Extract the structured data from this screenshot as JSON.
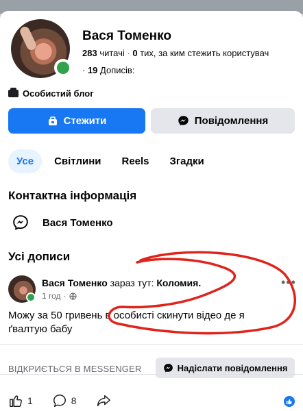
{
  "profile": {
    "name": "Вася Томенко",
    "followers_count": "283",
    "followers_label": "читачі",
    "following_count": "0",
    "following_label": "тих, за ким стежить користувач",
    "posts_count": "19",
    "posts_label": "Дописів:"
  },
  "category": "Особистий блог",
  "buttons": {
    "follow": "Стежити",
    "message": "Повідомлення"
  },
  "tabs": [
    {
      "label": "Усе",
      "active": true
    },
    {
      "label": "Світлини",
      "active": false
    },
    {
      "label": "Reels",
      "active": false
    },
    {
      "label": "Згадки",
      "active": false
    }
  ],
  "contact": {
    "title": "Контактна інформація",
    "messenger_name": "Вася Томенко"
  },
  "posts_section": {
    "title": "Усі дописи"
  },
  "post": {
    "author": "Вася Томенко",
    "location_prefix": "зараз тут:",
    "location": "Коломия.",
    "time": "1 год",
    "text": "Можу за 50 гривень в особисті скинути відео де я ґвалтую бабу",
    "messenger_prompt": "ВІДКРИЄТЬСЯ В MESSENGER",
    "send_button": "Надіслати повідомлення",
    "likes": "1",
    "comments": "8"
  },
  "colors": {
    "accent": "#1877f2",
    "online": "#31a24c",
    "annotation": "#e0231b"
  },
  "icons": {
    "follow": "follow-icon",
    "message": "messenger-icon",
    "like": "thumbs-up-icon",
    "comment": "comment-icon",
    "share": "share-icon"
  }
}
